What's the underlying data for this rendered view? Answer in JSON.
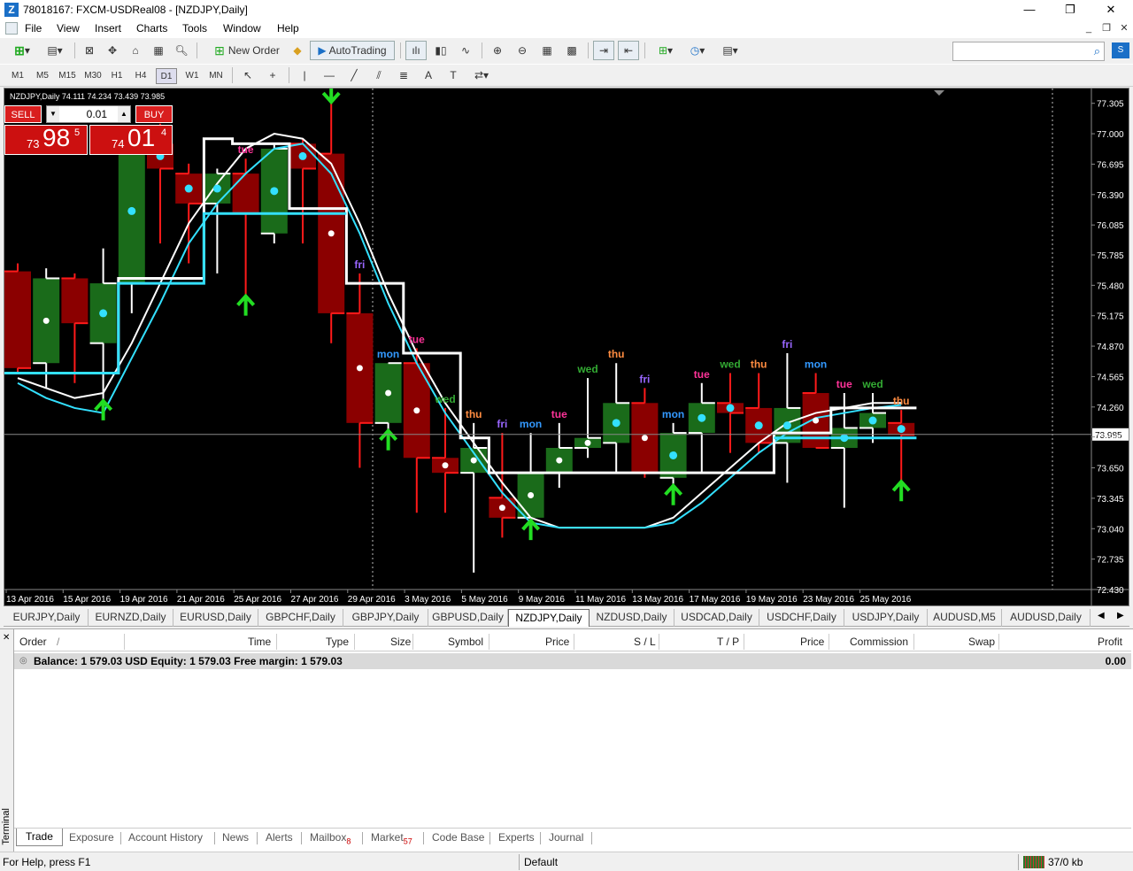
{
  "window": {
    "title": "78018167: FXCM-USDReal08 - [NZDJPY,Daily]",
    "minimize": "—",
    "maximize": "❐",
    "close": "✕"
  },
  "menu": [
    "File",
    "View",
    "Insert",
    "Charts",
    "Tools",
    "Window",
    "Help"
  ],
  "toolbar": {
    "new_order": "New Order",
    "autotrading": "AutoTrading",
    "timeframes": [
      "M1",
      "M5",
      "M15",
      "M30",
      "H1",
      "H4",
      "D1",
      "W1",
      "MN"
    ],
    "active_timeframe": "D1",
    "search_placeholder": ""
  },
  "chart": {
    "info": "NZDJPY,Daily  74.111 74.234 73.439 73.985",
    "symbol": "NZDJPY,Daily",
    "current_price": "73.985",
    "trade_panel": {
      "sell_label": "SELL",
      "buy_label": "BUY",
      "lot": "0.01",
      "sell_price": {
        "small": "73",
        "big": "98",
        "sup": "5"
      },
      "buy_price": {
        "small": "74",
        "big": "01",
        "sup": "4"
      }
    },
    "price_labels": [
      "77.305",
      "77.000",
      "76.695",
      "76.390",
      "76.085",
      "75.785",
      "75.480",
      "75.175",
      "74.870",
      "74.565",
      "74.260",
      "73.960",
      "73.650",
      "73.345",
      "73.040",
      "72.735",
      "72.430"
    ],
    "date_labels": [
      "13 Apr 2016",
      "15 Apr 2016",
      "19 Apr 2016",
      "21 Apr 2016",
      "25 Apr 2016",
      "27 Apr 2016",
      "29 Apr 2016",
      "3 May 2016",
      "5 May 2016",
      "9 May 2016",
      "11 May 2016",
      "13 May 2016",
      "17 May 2016",
      "19 May 2016",
      "23 May 2016",
      "25 May 2016"
    ],
    "day_labels": [
      {
        "text": "thu",
        "color": "#ff8c40"
      },
      {
        "text": "tue",
        "color": "#ff3399"
      },
      {
        "text": "fri",
        "color": "#9966ff"
      },
      {
        "text": "mon",
        "color": "#3399ff"
      },
      {
        "text": "tue",
        "color": "#ff3399"
      },
      {
        "text": "wed",
        "color": "#33aa33"
      },
      {
        "text": "thu",
        "color": "#ff8c40"
      },
      {
        "text": "fri",
        "color": "#9966ff"
      },
      {
        "text": "mon",
        "color": "#3399ff"
      },
      {
        "text": "tue",
        "color": "#ff3399"
      },
      {
        "text": "wed",
        "color": "#33aa33"
      },
      {
        "text": "thu",
        "color": "#ff8c40"
      },
      {
        "text": "fri",
        "color": "#9966ff"
      },
      {
        "text": "mon",
        "color": "#3399ff"
      },
      {
        "text": "tue",
        "color": "#ff3399"
      },
      {
        "text": "wed",
        "color": "#33aa33"
      },
      {
        "text": "thu",
        "color": "#ff8c40"
      },
      {
        "text": "fri",
        "color": "#9966ff"
      },
      {
        "text": "mon",
        "color": "#3399ff"
      },
      {
        "text": "tue",
        "color": "#ff3399"
      },
      {
        "text": "wed",
        "color": "#33aa33"
      },
      {
        "text": "thu",
        "color": "#ff8c40"
      }
    ],
    "colors": {
      "bull": "#1a6b1a",
      "bear": "#8b0000",
      "wick_bear": "#ff1a1a",
      "wick_bull": "#ffffff",
      "ma_cyan": "#33e0ff",
      "ma_white": "#ffffff",
      "arrow": "#22dd22"
    }
  },
  "chart_data": {
    "type": "candlestick",
    "ylim": [
      72.43,
      77.4
    ],
    "candles": [
      {
        "o": 75.62,
        "h": 75.7,
        "l": 74.6,
        "c": 74.65
      },
      {
        "o": 74.7,
        "h": 75.65,
        "l": 74.45,
        "c": 75.55
      },
      {
        "o": 75.55,
        "h": 75.6,
        "l": 74.5,
        "c": 75.1
      },
      {
        "o": 74.9,
        "h": 75.85,
        "l": 74.25,
        "c": 75.5
      },
      {
        "o": 75.5,
        "h": 77.0,
        "l": 75.2,
        "c": 76.95
      },
      {
        "o": 76.9,
        "h": 77.1,
        "l": 75.9,
        "c": 76.65
      },
      {
        "o": 76.6,
        "h": 76.7,
        "l": 75.7,
        "c": 76.3
      },
      {
        "o": 76.3,
        "h": 76.65,
        "l": 75.6,
        "c": 76.6
      },
      {
        "o": 76.6,
        "h": 76.75,
        "l": 75.3,
        "c": 76.2
      },
      {
        "o": 76.0,
        "h": 76.9,
        "l": 75.9,
        "c": 76.85
      },
      {
        "o": 76.9,
        "h": 76.95,
        "l": 75.9,
        "c": 76.65
      },
      {
        "o": 76.8,
        "h": 77.55,
        "l": 74.9,
        "c": 75.2
      },
      {
        "o": 75.2,
        "h": 75.6,
        "l": 73.65,
        "c": 74.1
      },
      {
        "o": 74.1,
        "h": 74.7,
        "l": 73.95,
        "c": 74.7
      },
      {
        "o": 74.7,
        "h": 74.85,
        "l": 73.2,
        "c": 73.75
      },
      {
        "o": 73.75,
        "h": 74.25,
        "l": 73.2,
        "c": 73.6
      },
      {
        "o": 73.6,
        "h": 74.1,
        "l": 72.6,
        "c": 73.85
      },
      {
        "o": 73.35,
        "h": 74.0,
        "l": 72.95,
        "c": 73.15
      },
      {
        "o": 73.15,
        "h": 74.0,
        "l": 73.05,
        "c": 73.6
      },
      {
        "o": 73.6,
        "h": 74.1,
        "l": 73.45,
        "c": 73.85
      },
      {
        "o": 73.85,
        "h": 74.55,
        "l": 73.75,
        "c": 73.95
      },
      {
        "o": 73.9,
        "h": 74.7,
        "l": 73.6,
        "c": 74.3
      },
      {
        "o": 74.3,
        "h": 74.45,
        "l": 73.55,
        "c": 73.6
      },
      {
        "o": 73.55,
        "h": 74.1,
        "l": 73.4,
        "c": 74.0
      },
      {
        "o": 74.0,
        "h": 74.5,
        "l": 73.6,
        "c": 74.3
      },
      {
        "o": 74.3,
        "h": 74.6,
        "l": 73.8,
        "c": 74.2
      },
      {
        "o": 74.25,
        "h": 74.6,
        "l": 73.8,
        "c": 73.9
      },
      {
        "o": 73.9,
        "h": 74.8,
        "l": 73.5,
        "c": 74.25
      },
      {
        "o": 74.4,
        "h": 74.6,
        "l": 73.85,
        "c": 73.85
      },
      {
        "o": 73.85,
        "h": 74.4,
        "l": 73.25,
        "c": 74.05
      },
      {
        "o": 74.05,
        "h": 74.4,
        "l": 73.9,
        "c": 74.2
      },
      {
        "o": 74.1,
        "h": 74.23,
        "l": 73.44,
        "c": 73.98
      }
    ],
    "ma_white": [
      74.55,
      74.45,
      74.35,
      74.4,
      74.9,
      75.5,
      76.1,
      76.5,
      76.85,
      77.0,
      76.95,
      76.7,
      76.1,
      75.4,
      74.8,
      74.3,
      73.9,
      73.5,
      73.15,
      73.05,
      73.05,
      73.05,
      73.05,
      73.15,
      73.4,
      73.65,
      73.9,
      74.1,
      74.2,
      74.25,
      74.3,
      74.3
    ],
    "ma_cyan": [
      74.5,
      74.35,
      74.25,
      74.2,
      74.75,
      75.3,
      75.9,
      76.3,
      76.6,
      76.85,
      76.9,
      76.6,
      76.0,
      75.3,
      74.7,
      74.2,
      73.8,
      73.4,
      73.1,
      73.05,
      73.05,
      73.05,
      73.05,
      73.1,
      73.3,
      73.55,
      73.8,
      74.0,
      74.15,
      74.2,
      74.25,
      74.28
    ],
    "stair_white": [
      74.6,
      74.6,
      74.6,
      74.6,
      75.55,
      75.55,
      75.55,
      76.95,
      76.9,
      76.9,
      76.25,
      76.25,
      75.5,
      75.5,
      74.8,
      74.8,
      73.95,
      73.6,
      73.6,
      73.6,
      73.6,
      73.6,
      73.6,
      73.6,
      73.6,
      73.6,
      73.6,
      74.0,
      74.0,
      74.25,
      74.25,
      74.25
    ],
    "stair_cyan": [
      74.6,
      74.6,
      74.6,
      74.6,
      75.5,
      75.5,
      75.5,
      76.2,
      76.2,
      76.2,
      76.2,
      76.2,
      null,
      null,
      null,
      null,
      null,
      null,
      null,
      null,
      null,
      null,
      null,
      null,
      null,
      null,
      null,
      73.95,
      73.95,
      73.95,
      73.95,
      73.95
    ],
    "up_arrows": [
      3,
      8,
      13,
      18,
      23,
      31
    ],
    "down_arrows": [
      11
    ],
    "dots_cyan": [
      3,
      4,
      5,
      6,
      7,
      9,
      10,
      21,
      23,
      24,
      25,
      26,
      27,
      29,
      30,
      31
    ],
    "dots_white": [
      1,
      11,
      12,
      13,
      14,
      15,
      16,
      17,
      18,
      19,
      20,
      22,
      28
    ]
  },
  "symbol_tabs": [
    "EURJPY,Daily",
    "EURNZD,Daily",
    "EURUSD,Daily",
    "GBPCHF,Daily",
    "GBPJPY,Daily",
    "GBPUSD,Daily",
    "NZDJPY,Daily",
    "NZDUSD,Daily",
    "USDCAD,Daily",
    "USDCHF,Daily",
    "USDJPY,Daily",
    "AUDUSD,M5",
    "AUDUSD,Daily"
  ],
  "active_symbol_tab": "NZDJPY,Daily",
  "terminal": {
    "side_label": "Terminal",
    "columns": [
      "Order",
      "Time",
      "Type",
      "Size",
      "Symbol",
      "Price",
      "S / L",
      "T / P",
      "Price",
      "Commission",
      "Swap",
      "Profit"
    ],
    "sort_mark": "/",
    "balance_text": "Balance: 1 579.03 USD  Equity: 1 579.03  Free margin: 1 579.03",
    "balance_profit": "0.00",
    "tabs": [
      {
        "label": "Trade",
        "badge": ""
      },
      {
        "label": "Exposure",
        "badge": ""
      },
      {
        "label": "Account History",
        "badge": ""
      },
      {
        "label": "News",
        "badge": ""
      },
      {
        "label": "Alerts",
        "badge": ""
      },
      {
        "label": "Mailbox",
        "badge": "8"
      },
      {
        "label": "Market",
        "badge": "57"
      },
      {
        "label": "Code Base",
        "badge": ""
      },
      {
        "label": "Experts",
        "badge": ""
      },
      {
        "label": "Journal",
        "badge": ""
      }
    ]
  },
  "status": {
    "help": "For Help, press F1",
    "profile": "Default",
    "traffic": "37/0 kb"
  }
}
